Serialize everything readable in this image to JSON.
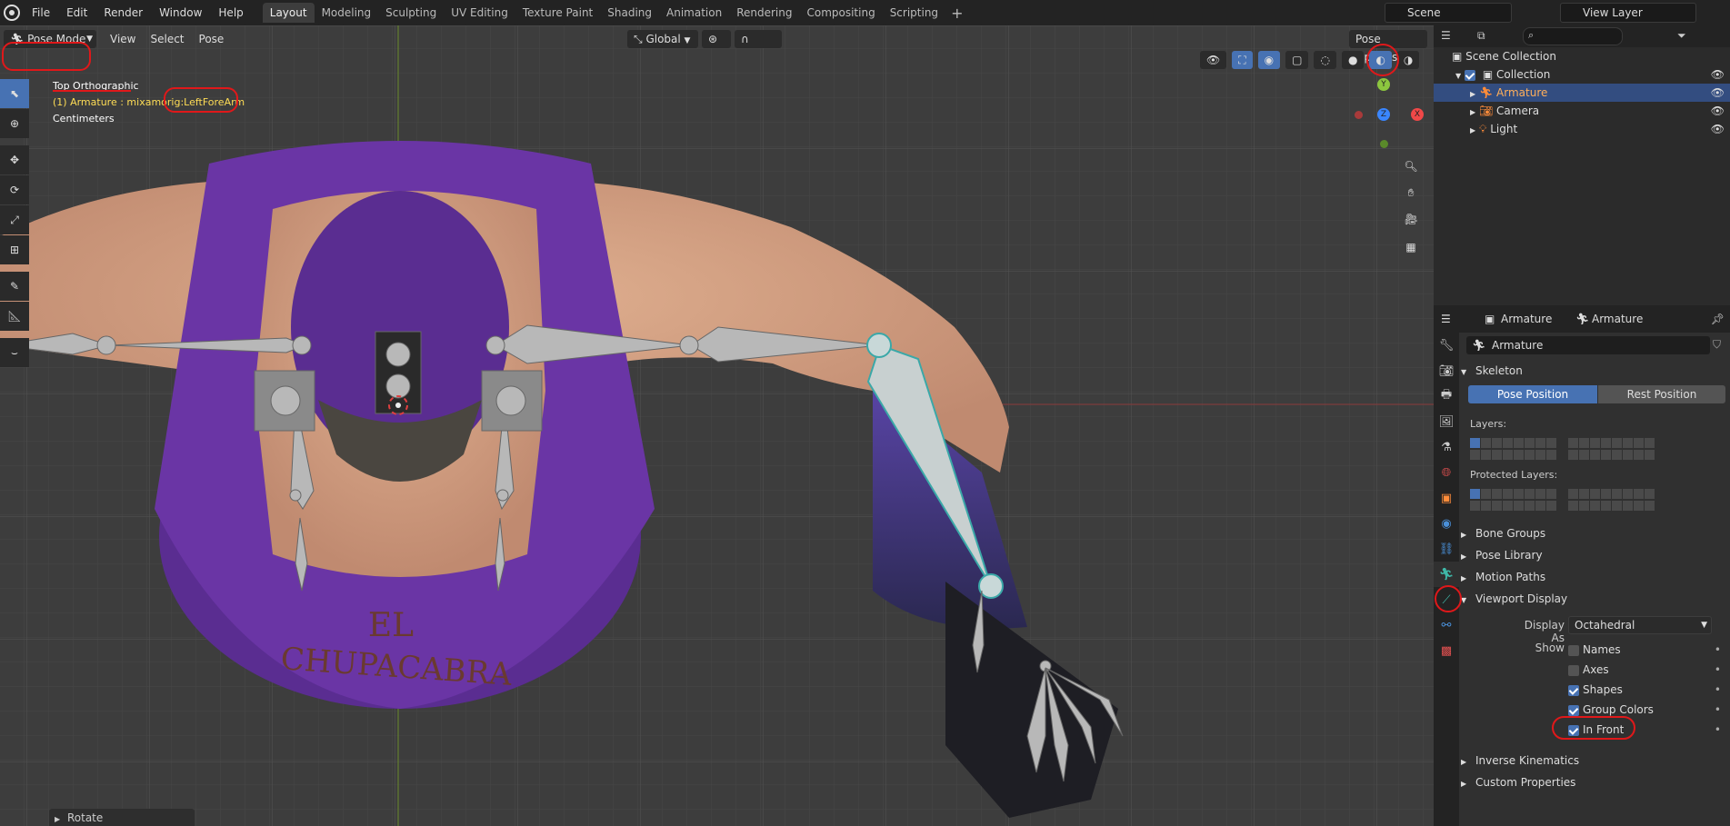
{
  "menu": {
    "file": "File",
    "edit": "Edit",
    "render": "Render",
    "window": "Window",
    "help": "Help"
  },
  "workspaces": [
    "Layout",
    "Modeling",
    "Sculpting",
    "UV Editing",
    "Texture Paint",
    "Shading",
    "Animation",
    "Rendering",
    "Compositing",
    "Scripting"
  ],
  "active_workspace": "Layout",
  "scene": {
    "label": "Scene",
    "view_layer": "View Layer"
  },
  "viewport_header": {
    "mode": "Pose Mode",
    "view": "View",
    "select": "Select",
    "pose": "Pose",
    "orientation": "Global",
    "pose_options": "Pose Options"
  },
  "viewport_info": {
    "view_name": "Top Orthographic",
    "object_line": "(1) Armature : mixamorig:LeftForeArm",
    "units": "Centimeters"
  },
  "shirt_text": {
    "line1": "EL",
    "line2": "CHUPACABRA"
  },
  "gizmo": {
    "x": "X",
    "y": "Y",
    "z": "Z"
  },
  "operator_panel": {
    "label": "Rotate"
  },
  "outliner": {
    "search_placeholder": "",
    "scene_collection": "Scene Collection",
    "collection": "Collection",
    "items": [
      "Armature",
      "Camera",
      "Light"
    ]
  },
  "properties": {
    "breadcrumb_object": "Armature",
    "breadcrumb_data": "Armature",
    "data_name": "Armature",
    "skeleton": {
      "title": "Skeleton",
      "pose_position": "Pose Position",
      "rest_position": "Rest Position",
      "layers_label": "Layers:",
      "protected_label": "Protected Layers:"
    },
    "collapsed_panels": [
      "Bone Groups",
      "Pose Library",
      "Motion Paths"
    ],
    "viewport_display": {
      "title": "Viewport Display",
      "display_as_label": "Display As",
      "display_as_value": "Octahedral",
      "show_label": "Show",
      "options": [
        {
          "label": "Names",
          "checked": false
        },
        {
          "label": "Axes",
          "checked": false
        },
        {
          "label": "Shapes",
          "checked": true
        },
        {
          "label": "Group Colors",
          "checked": true
        },
        {
          "label": "In Front",
          "checked": true
        }
      ]
    },
    "bottom_panels": [
      "Inverse Kinematics",
      "Custom Properties"
    ]
  },
  "colors": {
    "accent": "#4772b3",
    "annotation": "#e0181a",
    "jersey": "#5a2d91"
  }
}
